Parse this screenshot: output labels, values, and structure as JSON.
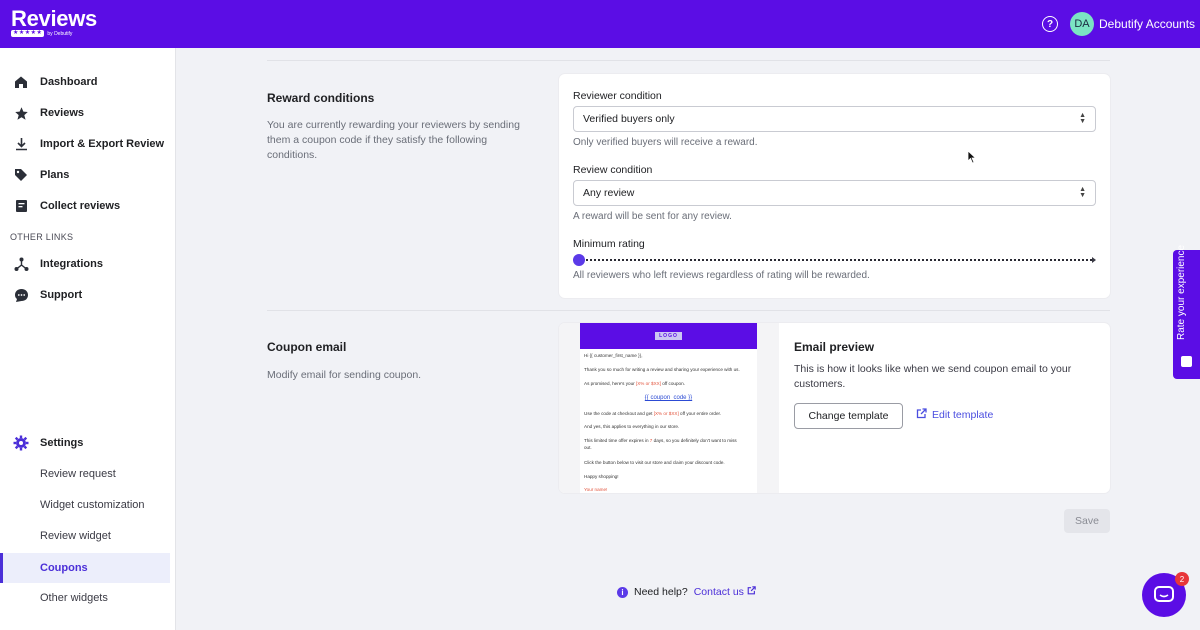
{
  "app": {
    "logo_text": "Reviews",
    "logo_sub": "by Debutify",
    "account_initials": "DA",
    "account_name": "Debutify Accounts"
  },
  "sidebar": {
    "items": [
      {
        "label": "Dashboard",
        "icon": "home-icon"
      },
      {
        "label": "Reviews",
        "icon": "star-icon"
      },
      {
        "label": "Import & Export Review",
        "icon": "download-icon"
      },
      {
        "label": "Plans",
        "icon": "tag-icon"
      },
      {
        "label": "Collect reviews",
        "icon": "clipboard-icon"
      }
    ],
    "other_links_label": "OTHER LINKS",
    "other_links": [
      {
        "label": "Integrations",
        "icon": "integrations-icon"
      },
      {
        "label": "Support",
        "icon": "chat-bubble-icon"
      }
    ],
    "settings_label": "Settings",
    "settings_sub": [
      {
        "label": "Review request"
      },
      {
        "label": "Widget customization"
      },
      {
        "label": "Review widget"
      },
      {
        "label": "Coupons",
        "active": true
      },
      {
        "label": "Other widgets"
      }
    ]
  },
  "reward": {
    "title": "Reward conditions",
    "description": "You are currently rewarding your reviewers by sending them a coupon code if they satisfy the following conditions.",
    "reviewer_condition_label": "Reviewer condition",
    "reviewer_condition_value": "Verified buyers only",
    "reviewer_condition_help": "Only verified buyers will receive a reward.",
    "review_condition_label": "Review condition",
    "review_condition_value": "Any review",
    "review_condition_help": "A reward will be sent for any review.",
    "min_rating_label": "Minimum rating",
    "min_rating_value": 0,
    "min_rating_help": "All reviewers who left reviews regardless of rating will be rewarded."
  },
  "coupon_email": {
    "title": "Coupon email",
    "description": "Modify email for sending coupon.",
    "preview_title": "Email preview",
    "preview_description": "This is how it looks like when we send coupon email to your customers.",
    "change_template_label": "Change template",
    "edit_template_label": "Edit template",
    "thumbnail": {
      "logo": "LOGO",
      "greeting": "Hi {{ customer_first_name }},",
      "line1": "Thank you so much for writing a review and sharing your experience with us.",
      "line2_pre": "As promised, here's your ",
      "line2_hl": "[X% or $XX]",
      "line2_post": " off coupon.",
      "coupon": "{{ coupon_code }}",
      "line3_pre": "Use the code at checkout and get ",
      "line3_hl": "[X% or $XX]",
      "line3_post": " off your entire order.",
      "line4": "And yes, this applies to everything in our store.",
      "line5_pre": "This limited time offer expires in ",
      "line5_hl": "7",
      "line5_post": " days, so you definitely don't want to miss",
      "line5b": "out.",
      "line6": "Click the button below to visit our store and claim your discount code.",
      "line7": "Happy shopping!",
      "signature": "Your name!"
    }
  },
  "save_label": "Save",
  "footer": {
    "help_text": "Need help?",
    "contact_label": "Contact us"
  },
  "rate_tab_label": "Rate your experience",
  "chat_badge_count": "2",
  "colors": {
    "brand": "#5b0de5",
    "accent": "#4b2fd8"
  }
}
